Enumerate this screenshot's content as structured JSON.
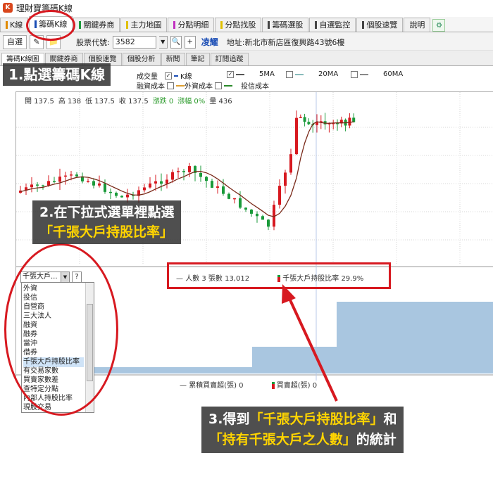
{
  "window": {
    "title": "理財寶籌碼K線",
    "app_icon": "K"
  },
  "main_tabs": [
    {
      "label": "K線",
      "mark": "#e08a00"
    },
    {
      "label": "籌碼K線",
      "mark": "#1a4db5",
      "active": true
    },
    {
      "label": "關鍵券商",
      "mark": "#1a9a3a"
    },
    {
      "label": "主力地圖",
      "mark": "#e0c000"
    },
    {
      "label": "分點明細",
      "mark": "#c030c0"
    },
    {
      "label": "分點找股",
      "mark": "#e0c000"
    },
    {
      "label": "籌碼選股",
      "mark": "#444444"
    },
    {
      "label": "自選監控",
      "mark": "#444444"
    },
    {
      "label": "個股速覽",
      "mark": "#444444"
    },
    {
      "label": "說明",
      "mark": ""
    }
  ],
  "toolbar": {
    "watchlist_label": "自選",
    "code_label": "股票代號:",
    "code_value": "3582",
    "add_label": "+",
    "stock_name": "凌耀",
    "address": "地址:新北市新店區復興路43號6樓"
  },
  "sub_tabs": [
    "籌碼K線圖",
    "關鍵券商",
    "個股速覽",
    "個股分析",
    "新聞",
    "筆記",
    "訂閱追蹤"
  ],
  "legend": {
    "volume": "成交量",
    "kline": "K線",
    "ma5": "5MA",
    "ma20": "20MA",
    "ma60": "60MA",
    "margin_cost": "融資成本",
    "foreign_cost": "外資成本",
    "trust_cost": "投信成本"
  },
  "price_info": {
    "open": "開 137.5",
    "high": "高 138",
    "low": "低 137.5",
    "close": "收 137.5",
    "change": "漲跌 0",
    "pct": "漲幅 0%",
    "volume": "量 436"
  },
  "panel2_legend": {
    "holders": "人數 3 張數 13,012",
    "ratio": "千張大戶持股比率 29.9%"
  },
  "panel3_legend": {
    "accum": "累積買賣超(張) 0",
    "net": "買賣超(張) 0"
  },
  "selector": {
    "selected": "千張大戶...",
    "help": "?",
    "options": [
      "外資",
      "投信",
      "自營商",
      "三大法人",
      "融資",
      "融券",
      "當沖",
      "借券",
      "千張大戶持股比率",
      "有交易家數",
      "買賣家數差",
      "查特定分點",
      "內部人持股比率",
      "現股交易"
    ],
    "selected_index": 8
  },
  "callouts": {
    "step1": "1.點選籌碼K線",
    "step2_line1": "2.在下拉式選單裡點選",
    "step2_line2": "「千張大戶持股比率」",
    "step3_line1_a": "3.得到",
    "step3_line1_b": "「千張大戶持股比率」",
    "step3_line1_c": "和",
    "step3_line2_a": "「持有千張大戶之人數」",
    "step3_line2_b": "的統計"
  },
  "colors": {
    "up": "#d71920",
    "down": "#1a9a3a",
    "ma": "#7a2a1a",
    "area": "#a9c6e0",
    "callout_red": "#d71920"
  }
}
